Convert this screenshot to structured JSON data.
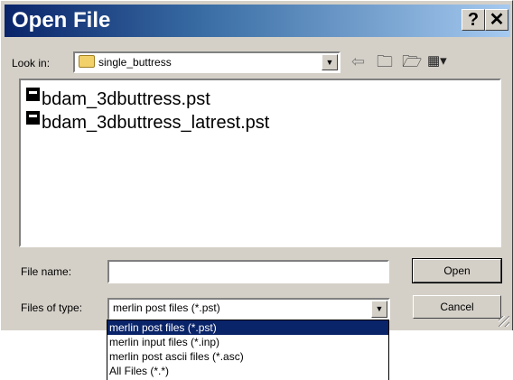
{
  "window": {
    "title": "Open File",
    "help_label": "?",
    "close_label": "✕"
  },
  "lookin": {
    "label": "Look in:",
    "value": "single_buttress"
  },
  "toolbar": {
    "back_icon": "back-arrow-icon",
    "up_icon": "up-folder-icon",
    "newfolder_icon": "new-folder-icon",
    "views_icon": "view-menu-icon"
  },
  "files": [
    {
      "name": "bdam_3dbuttress.pst"
    },
    {
      "name": "bdam_3dbuttress_latrest.pst"
    }
  ],
  "filename": {
    "label": "File name:",
    "value": ""
  },
  "filetype": {
    "label": "Files of type:",
    "value": "merlin post files (*.pst)"
  },
  "buttons": {
    "open": "Open",
    "cancel": "Cancel"
  },
  "filetype_options": [
    {
      "label": "merlin post files (*.pst)",
      "selected": true
    },
    {
      "label": "merlin input files (*.inp)",
      "selected": false
    },
    {
      "label": "merlin post ascii files (*.asc)",
      "selected": false
    },
    {
      "label": "All Files (*.*)",
      "selected": false
    }
  ]
}
